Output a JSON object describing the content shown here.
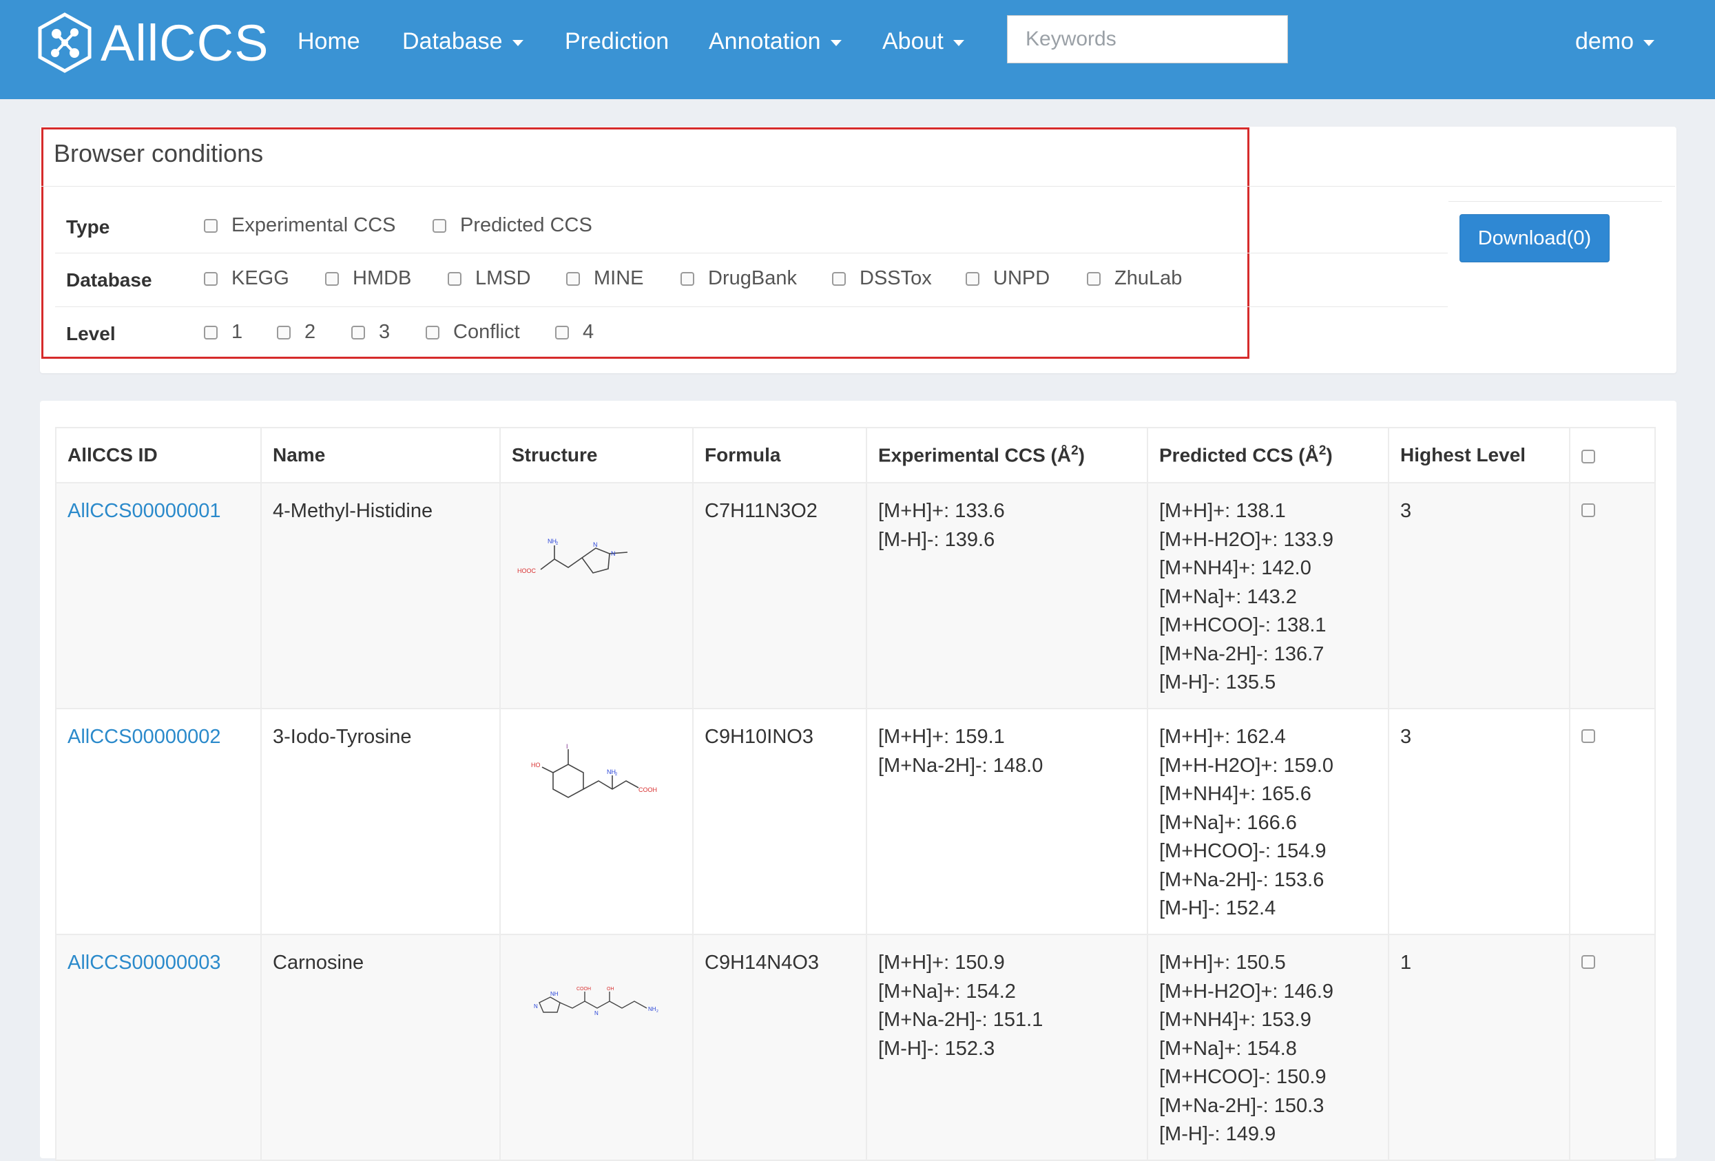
{
  "nav": {
    "brand": "AllCCS",
    "items": [
      {
        "label": "Home",
        "dropdown": false
      },
      {
        "label": "Database",
        "dropdown": true
      },
      {
        "label": "Prediction",
        "dropdown": false
      },
      {
        "label": "Annotation",
        "dropdown": true
      },
      {
        "label": "About",
        "dropdown": true
      }
    ],
    "search_placeholder": "Keywords",
    "user": "demo"
  },
  "conditions": {
    "title": "Browser conditions",
    "rows": [
      {
        "label": "Type",
        "options": [
          "Experimental CCS",
          "Predicted CCS"
        ]
      },
      {
        "label": "Database",
        "options": [
          "KEGG",
          "HMDB",
          "LMSD",
          "MINE",
          "DrugBank",
          "DSSTox",
          "UNPD",
          "ZhuLab"
        ]
      },
      {
        "label": "Level",
        "options": [
          "1",
          "2",
          "3",
          "Conflict",
          "4"
        ]
      }
    ],
    "download_label": "Download(0)"
  },
  "table": {
    "headers": {
      "id": "AllCCS ID",
      "name": "Name",
      "structure": "Structure",
      "formula": "Formula",
      "exp_ccs": "Experimental CCS (Å",
      "pred_ccs": "Predicted CCS (Å",
      "unit_sup": "2",
      "close_paren": ")",
      "level": "Highest Level"
    },
    "rows": [
      {
        "id": "AllCCS00000001",
        "name": "4-Methyl-Histidine",
        "formula": "C7H11N3O2",
        "exp": [
          "[M+H]+: 133.6",
          "[M-H]-: 139.6"
        ],
        "pred": [
          "[M+H]+: 138.1",
          "[M+H-H2O]+: 133.9",
          "[M+NH4]+: 142.0",
          "[M+Na]+: 143.2",
          "[M+HCOO]-: 138.1",
          "[M+Na-2H]-: 136.7",
          "[M-H]-: 135.5"
        ],
        "level": "3",
        "structure_labels": [
          "NH",
          "2",
          "HOOC",
          "N",
          "N"
        ]
      },
      {
        "id": "AllCCS00000002",
        "name": "3-Iodo-Tyrosine",
        "formula": "C9H10INO3",
        "exp": [
          "[M+H]+: 159.1",
          "[M+Na-2H]-: 148.0"
        ],
        "pred": [
          "[M+H]+: 162.4",
          "[M+H-H2O]+: 159.0",
          "[M+NH4]+: 165.6",
          "[M+Na]+: 166.6",
          "[M+HCOO]-: 154.9",
          "[M+Na-2H]-: 153.6",
          "[M-H]-: 152.4"
        ],
        "level": "3",
        "structure_labels": [
          "I",
          "HO",
          "NH",
          "2",
          "COOH"
        ]
      },
      {
        "id": "AllCCS00000003",
        "name": "Carnosine",
        "formula": "C9H14N4O3",
        "exp": [
          "[M+H]+: 150.9",
          "[M+Na]+: 154.2",
          "[M+Na-2H]-: 151.1",
          "[M-H]-: 152.3"
        ],
        "pred": [
          "[M+H]+: 150.5",
          "[M+H-H2O]+: 146.9",
          "[M+NH4]+: 153.9",
          "[M+Na]+: 154.8",
          "[M+HCOO]-: 150.9",
          "[M+Na-2H]-: 150.3",
          "[M-H]-: 149.9"
        ],
        "level": "1",
        "structure_labels": [
          "NH",
          "N",
          "COOH",
          "OH",
          "N",
          "NH",
          "2"
        ]
      }
    ]
  }
}
